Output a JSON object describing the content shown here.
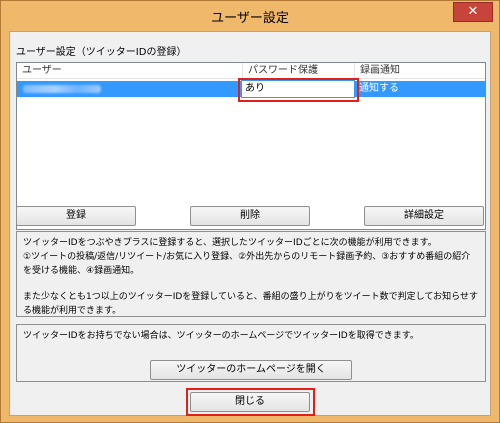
{
  "window": {
    "title": "ユーザー設定",
    "close_glyph": "✕"
  },
  "group_label": "ユーザー設定（ツイッターIDの登録）",
  "list": {
    "columns": [
      "ユーザー",
      "パスワード保護",
      "録画通知"
    ],
    "rows": [
      {
        "password_protect": "あり",
        "notify": "通知する"
      }
    ]
  },
  "buttons": {
    "register": "登録",
    "delete": "削除",
    "details": "詳細設定",
    "open_homepage": "ツイッターのホームページを開く",
    "close": "閉じる"
  },
  "info1": {
    "line1": "ツイッターIDをつぶやきプラスに登録すると、選択したツイッターIDごとに次の機能が利用できます。",
    "line2": "①ツイートの投稿/返信/リツイート/お気に入り登録、②外出先からのリモート録画予約、③おすすめ番組の紹介を受ける機能、④録画通知。",
    "line3": "また少なくとも1つ以上のツイッターIDを登録していると、番組の盛り上がりをツイート数で判定してお知らせする機能が利用できます。"
  },
  "info2": {
    "text": "ツイッターIDをお持ちでない場合は、ツイッターのホームページでツイッターIDを取得できます。"
  },
  "colors": {
    "title_bar": "#f0b86a",
    "selection": "#3399ff",
    "highlight_box": "#e0201b"
  }
}
